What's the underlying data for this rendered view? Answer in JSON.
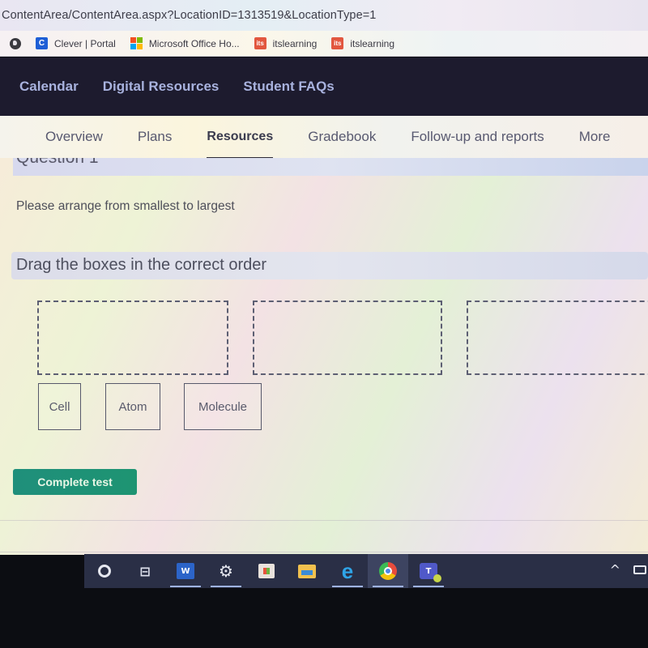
{
  "browser": {
    "url": "ContentArea/ContentArea.aspx?LocationID=1313519&LocationType=1",
    "bookmarks": [
      {
        "label": "Clever | Portal",
        "icon": "clever-icon",
        "icon_text": "C"
      },
      {
        "label": "Microsoft Office Ho...",
        "icon": "microsoft-office-icon"
      },
      {
        "label": "itslearning",
        "icon": "itslearning-icon",
        "icon_text": "its"
      },
      {
        "label": "itslearning",
        "icon": "itslearning-icon",
        "icon_text": "its"
      }
    ]
  },
  "topnav": {
    "items": [
      "Calendar",
      "Digital Resources",
      "Student FAQs"
    ]
  },
  "tabs": {
    "items": [
      "Overview",
      "Plans",
      "Resources",
      "Gradebook",
      "Follow-up and reports",
      "More"
    ],
    "active": "Resources"
  },
  "question": {
    "title": "Question 1",
    "prompt": "Please arrange from smallest to largest",
    "instruction": "Drag the boxes in the correct order",
    "drop_zones": 3,
    "tiles": [
      "Cell",
      "Atom",
      "Molecule"
    ],
    "complete_label": "Complete test"
  },
  "taskbar": {
    "items": [
      {
        "name": "cortana-icon"
      },
      {
        "name": "task-view-icon",
        "glyph": "⊟"
      },
      {
        "name": "word-icon",
        "glyph": "W",
        "running": true
      },
      {
        "name": "settings-gear-icon",
        "glyph": "⚙",
        "running": true
      },
      {
        "name": "microsoft-store-icon"
      },
      {
        "name": "file-explorer-icon"
      },
      {
        "name": "edge-icon",
        "glyph": "e",
        "running": true
      },
      {
        "name": "chrome-icon",
        "running": true,
        "active": true
      },
      {
        "name": "teams-icon",
        "glyph": "T",
        "running": true
      }
    ],
    "tray_chevron": "^"
  },
  "colors": {
    "nav_bg": "#1d1b2e",
    "nav_text": "#a8b2de",
    "complete_button": "#1f8f7b",
    "taskbar_bg": "#2a2f46"
  }
}
